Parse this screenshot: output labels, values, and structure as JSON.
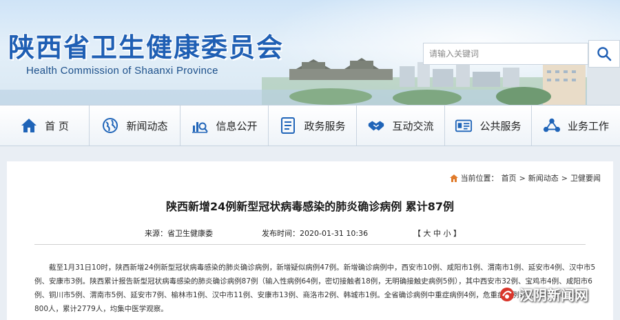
{
  "header": {
    "title": "陕西省卫生健康委员会",
    "subtitle": "Health Commission of Shaanxi Province",
    "search_placeholder": "请输入关键词",
    "search_icon": "search-icon"
  },
  "nav": {
    "items": [
      {
        "label": "首 页",
        "icon": "home-icon"
      },
      {
        "label": "新闻动态",
        "icon": "globe-icon"
      },
      {
        "label": "信息公开",
        "icon": "chart-icon"
      },
      {
        "label": "政务服务",
        "icon": "document-icon"
      },
      {
        "label": "互动交流",
        "icon": "handshake-icon"
      },
      {
        "label": "公共服务",
        "icon": "id-card-icon"
      },
      {
        "label": "业务工作",
        "icon": "network-icon"
      }
    ]
  },
  "breadcrumb": {
    "prefix": "当前位置：",
    "items": [
      "首页",
      "新闻动态",
      "卫健要闻"
    ],
    "separator": ">"
  },
  "article": {
    "title": "陕西新增24例新型冠状病毒感染的肺炎确诊病例 累计87例",
    "source": "来源：省卫生健康委",
    "date": "发布时间：2020-01-31 10:36",
    "font_size_control": "【 大 中 小 】",
    "body": "截至1月31日10时，陕西新增24例新型冠状病毒感染的肺炎确诊病例，新增疑似病例47例。新增确诊病例中，西安市10例、咸阳市1例、渭南市1例、延安市4例、汉中市5例、安康市3例。陕西累计报告新型冠状病毒感染的肺炎确诊病例87例（输入性病例64例，密切接触者18例，无明确接触史病例5例），其中西安市32例、宝鸡市4例、咸阳市6例、铜川市5例、渭南市5例、延安市7例、榆林市1例、汉中市11例、安康市13例、商洛市2例、韩城市1例。全省确诊病例中重症病例4例，危重症病例1例，新增密切接触者800人，累计2779人，均集中医学观察。"
  },
  "watermark": "汉阴新闻网",
  "colors": {
    "title_blue": "#1f5fb4",
    "nav_bg": "#ffffff",
    "page_bg": "#e9eef4"
  }
}
